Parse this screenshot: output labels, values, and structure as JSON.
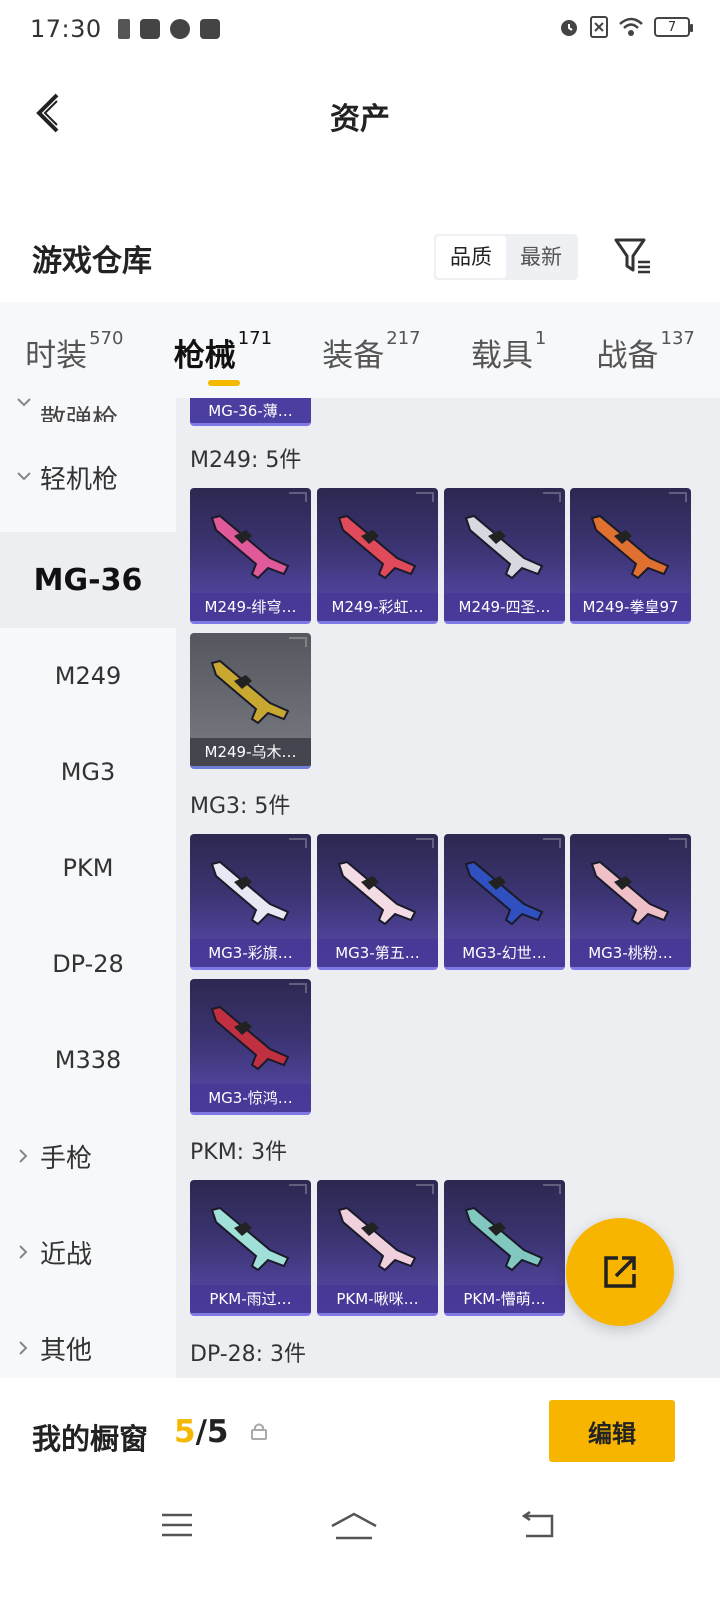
{
  "status_bar": {
    "time": "17:30",
    "battery": "7"
  },
  "header": {
    "title": "资产"
  },
  "warehouse": {
    "title": "游戏仓库",
    "sort_options": [
      "品质",
      "最新"
    ],
    "active_sort": "品质"
  },
  "tabs": [
    {
      "label": "时装",
      "count": "570"
    },
    {
      "label": "枪械",
      "count": "171"
    },
    {
      "label": "装备",
      "count": "217"
    },
    {
      "label": "载具",
      "count": "1"
    },
    {
      "label": "战备",
      "count": "137"
    }
  ],
  "active_tab": "枪械",
  "sidebar": {
    "partial_top": "散弹枪",
    "group_open": "轻机枪",
    "items": [
      "MG-36",
      "M249",
      "MG3",
      "PKM",
      "DP-28",
      "M338"
    ],
    "active_item": "MG-36",
    "groups_closed": [
      "手枪",
      "近战",
      "其他"
    ]
  },
  "content": {
    "partial_card": "MG-36-薄…",
    "sections": [
      {
        "title": "M249: 5件",
        "cards": [
          {
            "label": "M249-绯穹…",
            "palette": "#e05a9a"
          },
          {
            "label": "M249-彩虹…",
            "palette": "#e04a5a"
          },
          {
            "label": "M249-四圣…",
            "palette": "#d8d8e0"
          },
          {
            "label": "M249-拳皇97",
            "palette": "#e07030"
          },
          {
            "label": "M249-乌木…",
            "palette": "#c8a830",
            "gray": true
          }
        ]
      },
      {
        "title": "MG3: 5件",
        "cards": [
          {
            "label": "MG3-彩旗…",
            "palette": "#e8e8f4"
          },
          {
            "label": "MG3-第五…",
            "palette": "#f4dce4"
          },
          {
            "label": "MG3-幻世…",
            "palette": "#3050c0"
          },
          {
            "label": "MG3-桃粉…",
            "palette": "#f0c0c8"
          },
          {
            "label": "MG3-惊鸿…",
            "palette": "#c03040"
          }
        ]
      },
      {
        "title": "PKM: 3件",
        "cards": [
          {
            "label": "PKM-雨过…",
            "palette": "#a0e0d8"
          },
          {
            "label": "PKM-啾咪…",
            "palette": "#f0d0dc"
          },
          {
            "label": "PKM-懵萌…",
            "palette": "#80c8c0"
          }
        ]
      },
      {
        "title": "DP-28: 3件",
        "cards": []
      }
    ]
  },
  "bottom_bar": {
    "showcase_label": "我的橱窗",
    "showcase_current": "5",
    "showcase_sep_total": "/5",
    "edit_label": "编辑"
  },
  "colors": {
    "accent": "#f7b500",
    "card_purple": "#3b3472"
  }
}
